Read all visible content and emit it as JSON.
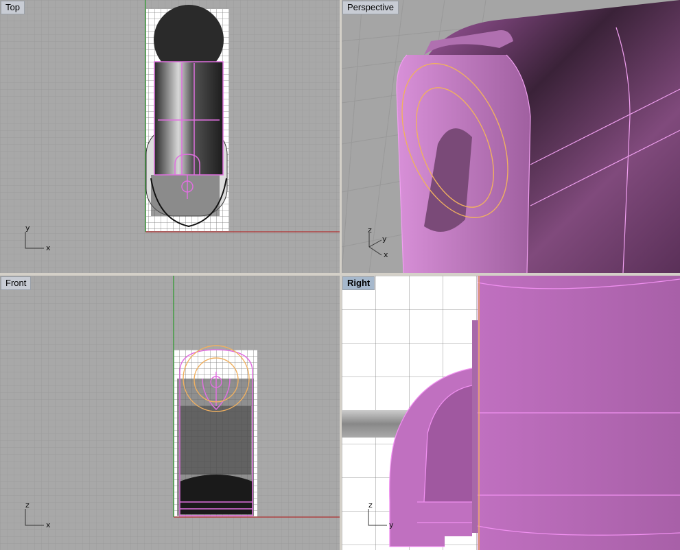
{
  "viewports": {
    "top": {
      "label": "Top",
      "axes": {
        "a": "y",
        "b": "x"
      }
    },
    "perspective": {
      "label": "Perspective",
      "axes": {
        "z": "z",
        "y": "y",
        "x": "x"
      }
    },
    "front": {
      "label": "Front",
      "axes": {
        "a": "z",
        "b": "x"
      }
    },
    "right": {
      "label": "Right",
      "axes": {
        "a": "z",
        "b": "y"
      },
      "active": true
    }
  },
  "colors": {
    "viewport_bg": "#a9a9a9",
    "grid_minor": "#9c9c9c",
    "grid_major": "#8a8a8a",
    "x_axis": "#b03030",
    "y_axis": "#2a9a2a",
    "selection": "#e070e0",
    "selection_fill": "#c070c0",
    "highlight": "#f0b060",
    "divider": "#e8e8e8"
  }
}
